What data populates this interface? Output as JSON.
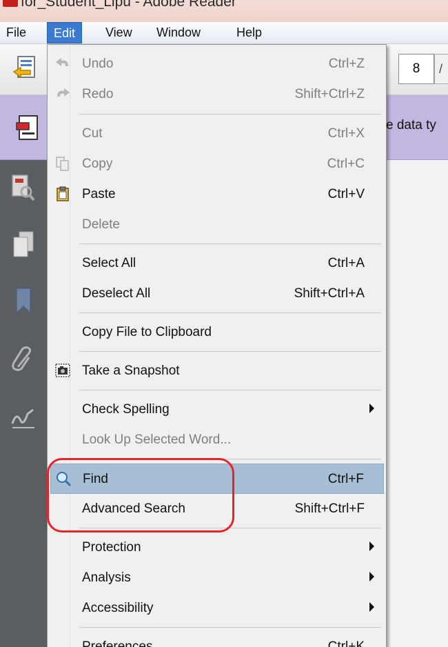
{
  "window": {
    "title": "for_Student_Lipu - Adobe Reader"
  },
  "menubar": {
    "items": [
      {
        "label": "File"
      },
      {
        "label": "Edit"
      },
      {
        "label": "View"
      },
      {
        "label": "Window"
      },
      {
        "label": "Help"
      }
    ]
  },
  "toolbar": {
    "page_number": "8"
  },
  "notice": {
    "text": "e data ty"
  },
  "edit_menu": {
    "items": [
      {
        "label": "Undo",
        "shortcut": "Ctrl+Z",
        "disabled": true,
        "icon": "undo-icon"
      },
      {
        "label": "Redo",
        "shortcut": "Shift+Ctrl+Z",
        "disabled": true,
        "icon": "redo-icon"
      },
      {
        "label": "Cut",
        "shortcut": "Ctrl+X",
        "disabled": true
      },
      {
        "label": "Copy",
        "shortcut": "Ctrl+C",
        "disabled": true,
        "icon": "copy-icon"
      },
      {
        "label": "Paste",
        "shortcut": "Ctrl+V",
        "disabled": false,
        "icon": "clipboard-icon"
      },
      {
        "label": "Delete",
        "shortcut": "",
        "disabled": true
      },
      {
        "label": "Select All",
        "shortcut": "Ctrl+A",
        "disabled": false
      },
      {
        "label": "Deselect All",
        "shortcut": "Shift+Ctrl+A",
        "disabled": false
      },
      {
        "label": "Copy File to Clipboard",
        "shortcut": "",
        "disabled": false
      },
      {
        "label": "Take a Snapshot",
        "shortcut": "",
        "disabled": false,
        "icon": "camera-icon"
      },
      {
        "label": "Check Spelling",
        "shortcut": "",
        "disabled": false,
        "submenu": true
      },
      {
        "label": "Look Up Selected Word...",
        "shortcut": "",
        "disabled": true
      },
      {
        "label": "Find",
        "shortcut": "Ctrl+F",
        "disabled": false,
        "icon": "search-icon",
        "highlighted": true
      },
      {
        "label": "Advanced Search",
        "shortcut": "Shift+Ctrl+F",
        "disabled": false
      },
      {
        "label": "Protection",
        "shortcut": "",
        "disabled": false,
        "submenu": true
      },
      {
        "label": "Analysis",
        "shortcut": "",
        "disabled": false,
        "submenu": true
      },
      {
        "label": "Accessibility",
        "shortcut": "",
        "disabled": false,
        "submenu": true
      },
      {
        "label": "Preferences...",
        "shortcut": "Ctrl+K",
        "disabled": false
      }
    ]
  },
  "colors": {
    "menu_active": "#3b7ad1",
    "highlight": "#a7bfd5",
    "annotation": "#e8232a",
    "notice_bar": "#c3b6e0",
    "left_panel": "#5a5d62"
  }
}
